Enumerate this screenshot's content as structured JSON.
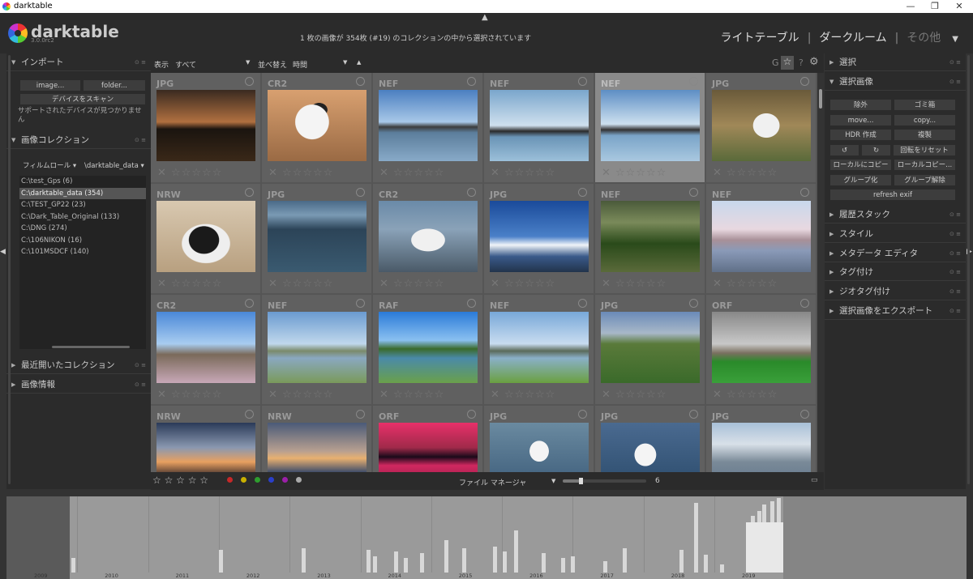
{
  "window": {
    "title": "darktable",
    "minimize": "—",
    "maximize": "❐",
    "close": "✕"
  },
  "header": {
    "logo_text": "darktable",
    "version": "3.0.0rc2",
    "collection_info": "1 枚の画像が 354枚 (#19) のコレクションの中から選択されています",
    "views": {
      "lighttable": "ライトテーブル",
      "darkroom": "ダークルーム",
      "other": "その他",
      "sep": "|"
    }
  },
  "left": {
    "import": {
      "title": "インポート",
      "image_btn": "image...",
      "folder_btn": "folder...",
      "scan_btn": "デバイスをスキャン",
      "no_device": "サポートされたデバイスが見つかりません"
    },
    "collect": {
      "title": "画像コレクション",
      "filter_label": "フィルムロール",
      "filter_value": "\\darktable_data",
      "rolls": [
        "C:\\test_Gps (6)",
        "C:\\darktable_data (354)",
        "C:\\TEST_GP22 (23)",
        "C:\\Dark_Table_Original (133)",
        "C:\\DNG (274)",
        "C:\\106NIKON (16)",
        "C:\\101MSDCF (140)"
      ]
    },
    "recent": {
      "title": "最近開いたコレクション"
    },
    "info": {
      "title": "画像情報"
    }
  },
  "toolbar": {
    "show_label": "表示",
    "show_value": "すべて",
    "sort_label": "並べ替え",
    "sort_value": "時間",
    "g": "G",
    "star": "☆",
    "help": "?",
    "gear": "⚙"
  },
  "right": {
    "select": {
      "title": "選択"
    },
    "selected": {
      "title": "選択画像",
      "buttons": [
        "除外",
        "ゴミ箱",
        "move...",
        "copy...",
        "HDR 作成",
        "複製",
        "↺",
        "↻",
        "回転をリセット",
        "ローカルにコピー",
        "ローカルコピー...",
        "グループ化",
        "グループ解除",
        "refresh exif"
      ]
    },
    "modules": [
      "履歴スタック",
      "スタイル",
      "メタデータ エディタ",
      "タグ付け",
      "ジオタグ付け",
      "選択画像をエクスポート"
    ]
  },
  "grid": {
    "cells": [
      {
        "ext": "JPG",
        "thumb": "sunset-lake"
      },
      {
        "ext": "CR2",
        "thumb": "chihuahua-floor"
      },
      {
        "ext": "NEF",
        "thumb": "harbor-fuji"
      },
      {
        "ext": "NEF",
        "thumb": "harbor-pier"
      },
      {
        "ext": "NEF",
        "thumb": "harbor-boat"
      },
      {
        "ext": "JPG",
        "thumb": "dog-leaves"
      },
      {
        "ext": "NRW",
        "thumb": "chihuahua-face"
      },
      {
        "ext": "JPG",
        "thumb": "aerial-fuji"
      },
      {
        "ext": "CR2",
        "thumb": "fuji-aerial"
      },
      {
        "ext": "JPG",
        "thumb": "fuji-sky"
      },
      {
        "ext": "NEF",
        "thumb": "skunk-cabbage"
      },
      {
        "ext": "NEF",
        "thumb": "river-sakura"
      },
      {
        "ext": "CR2",
        "thumb": "castle-sakura"
      },
      {
        "ext": "NEF",
        "thumb": "lake-park"
      },
      {
        "ext": "RAF",
        "thumb": "lake-trees"
      },
      {
        "ext": "NEF",
        "thumb": "pavilion-lake"
      },
      {
        "ext": "JPG",
        "thumb": "green-hills"
      },
      {
        "ext": "ORF",
        "thumb": "green-field"
      },
      {
        "ext": "NRW",
        "thumb": "cloud-sunset"
      },
      {
        "ext": "NRW",
        "thumb": "mountain-dusk"
      },
      {
        "ext": "ORF",
        "thumb": "red-sunset"
      },
      {
        "ext": "JPG",
        "thumb": "seagulls"
      },
      {
        "ext": "JPG",
        "thumb": "seagull-water"
      },
      {
        "ext": "JPG",
        "thumb": "canal-birds"
      }
    ],
    "stars": "✕ ☆☆☆☆☆"
  },
  "bottombar": {
    "stars": "☆ ☆ ☆ ☆ ☆",
    "layout": "ファイル マネージャ",
    "zoom": "6",
    "colors": [
      "#c62828",
      "#c9b000",
      "#2e9e2e",
      "#2a3fc9",
      "#9b1fa8",
      "#aaaaaa"
    ]
  },
  "timeline": {
    "years": [
      "2009",
      "2010",
      "2011",
      "2012",
      "2013",
      "2014",
      "2015",
      "2016",
      "2017",
      "2018",
      "2019"
    ]
  }
}
